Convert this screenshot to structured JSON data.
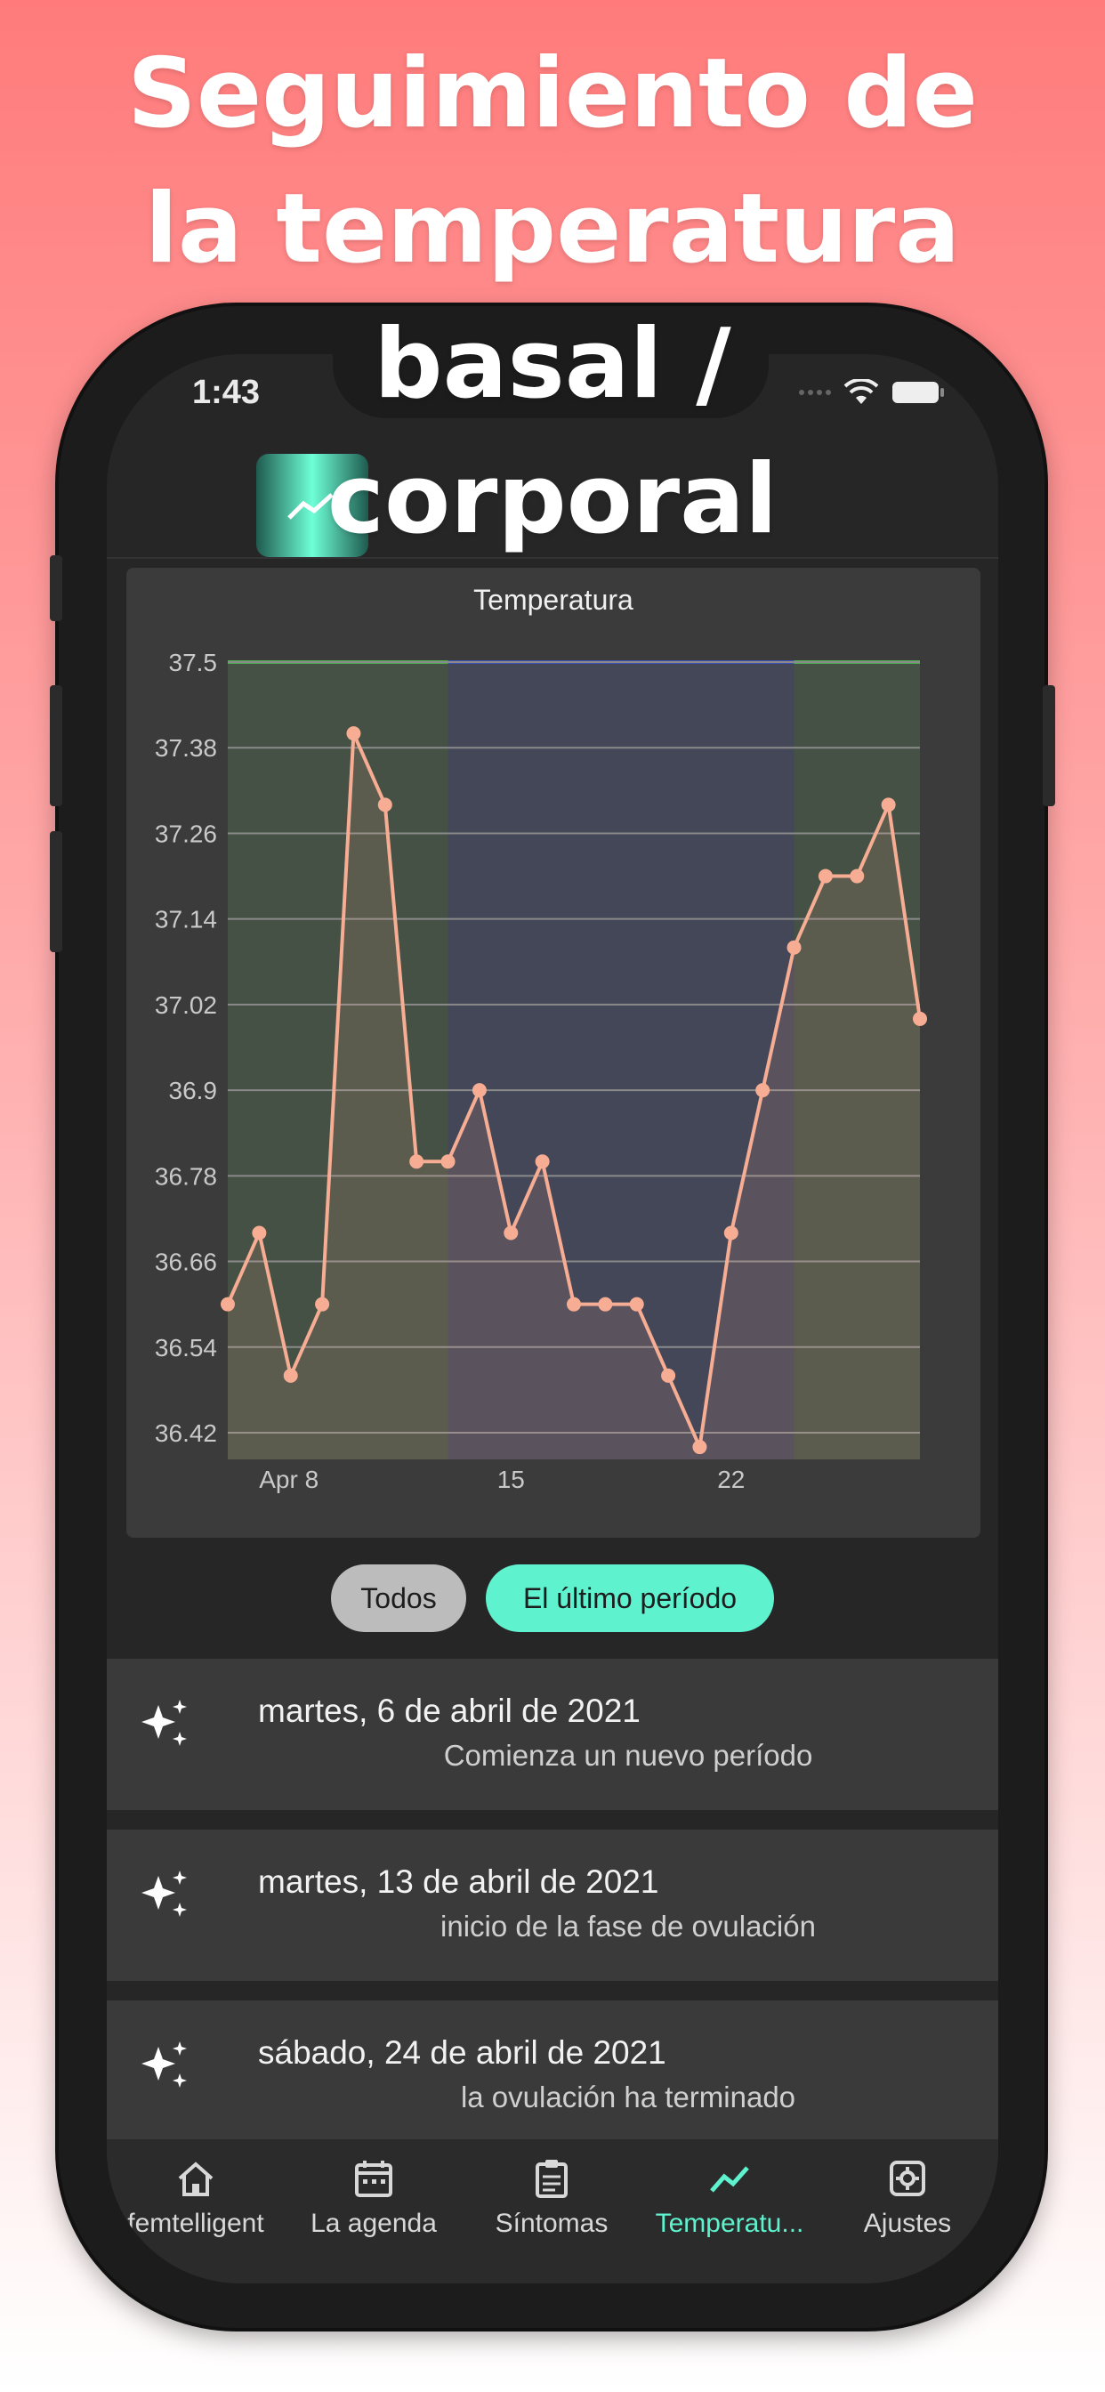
{
  "headline": [
    "Seguimiento de",
    "la temperatura",
    "basal /",
    "corporal"
  ],
  "status_time": "1:43",
  "chart_data": {
    "type": "line",
    "title": "Temperatura",
    "x_tick_labels": [
      "Apr 8",
      "15",
      "22"
    ],
    "y_tick_labels": [
      "37.5",
      "37.38",
      "37.26",
      "37.14",
      "37.02",
      "36.9",
      "36.78",
      "36.66",
      "36.54",
      "36.42"
    ],
    "ylim": [
      36.42,
      37.5
    ],
    "x_days": [
      6,
      7,
      8,
      9,
      10,
      11,
      12,
      13,
      14,
      15,
      16,
      17,
      18,
      19,
      20,
      21,
      22,
      23,
      24,
      25,
      26,
      27,
      28
    ],
    "values": [
      36.6,
      36.7,
      36.5,
      36.6,
      37.4,
      37.3,
      36.8,
      36.8,
      36.9,
      36.7,
      36.8,
      36.6,
      36.6,
      36.6,
      36.5,
      36.4,
      36.7,
      36.9,
      37.1,
      37.2,
      37.2,
      37.3,
      37.0
    ],
    "phases": [
      {
        "start_day": 6,
        "end_day": 13,
        "color": "#445144"
      },
      {
        "start_day": 13,
        "end_day": 24,
        "color": "#434757"
      },
      {
        "start_day": 24,
        "end_day": 28,
        "color": "#445144"
      }
    ],
    "colors": {
      "line": "#f7ad93",
      "grid": "#8a8a8a",
      "top_green": "#4caf50",
      "top_blue": "#3f51b5"
    }
  },
  "filters": {
    "all": "Todos",
    "last_period": "El último período"
  },
  "events": [
    {
      "date": "martes, 6 de abril de 2021",
      "desc": "Comienza un nuevo período"
    },
    {
      "date": "martes, 13 de abril de 2021",
      "desc": "inicio de la fase de ovulación"
    },
    {
      "date": "sábado, 24 de abril de 2021",
      "desc": "la ovulación ha terminado"
    }
  ],
  "nav": [
    {
      "label": "femtelligent",
      "icon": "home-icon"
    },
    {
      "label": "La agenda",
      "icon": "calendar-icon"
    },
    {
      "label": "Síntomas",
      "icon": "clipboard-icon"
    },
    {
      "label": "Temperatu...",
      "icon": "trend-icon",
      "active": true
    },
    {
      "label": "Ajustes",
      "icon": "gear-icon"
    }
  ],
  "accent_color": "#5ef2cf"
}
